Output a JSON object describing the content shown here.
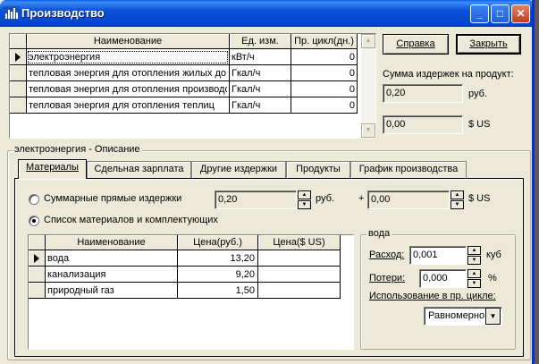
{
  "window": {
    "title": "Производство",
    "buttons": {
      "minimize": "_",
      "maximize": "□",
      "close": "✕"
    }
  },
  "products_table": {
    "columns": [
      "Наименование",
      "Ед. изм.",
      "Пр. цикл(дн.)"
    ],
    "rows": [
      {
        "name": "электроэнергия",
        "unit": "кВт/ч",
        "cycle": "0"
      },
      {
        "name": "тепловая энергия для отопления жилых до",
        "unit": "Гкал/ч",
        "cycle": "0"
      },
      {
        "name": "тепловая энергия для отопления производс",
        "unit": "Гкал/ч",
        "cycle": "0"
      },
      {
        "name": "тепловая энергия для отопления теплиц",
        "unit": "Гкал/ч",
        "cycle": "0"
      }
    ]
  },
  "right_panel": {
    "help_button": "Справка",
    "close_button": "Закрыть",
    "sum_label": "Сумма издержек на продукт:",
    "sum_rub_value": "0,20",
    "sum_rub_unit": "руб.",
    "sum_usd_value": "0,00",
    "sum_usd_unit": "$ US"
  },
  "description_group": {
    "legend": "электроэнергия - Описание",
    "tabs": [
      "Материалы",
      "Сдельная зарплата",
      "Другие издержки",
      "Продукты",
      "График производства"
    ],
    "active_tab": "Материалы"
  },
  "materials": {
    "radio_total_label": "Суммарные прямые издержки",
    "total_rub_value": "0,20",
    "total_rub_unit": "руб.",
    "plus": "+",
    "total_usd_value": "0,00",
    "total_usd_unit": "$ US",
    "radio_list_label": "Список материалов и комплектующих",
    "selected_radio": "list",
    "table": {
      "columns": [
        "Наименование",
        "Цена(руб.)",
        "Цена($ US)"
      ],
      "rows": [
        {
          "name": "вода",
          "rub": "13,20",
          "usd": ""
        },
        {
          "name": "канализация",
          "rub": "9,20",
          "usd": ""
        },
        {
          "name": "природный газ",
          "rub": "1,50",
          "usd": ""
        }
      ]
    }
  },
  "water_group": {
    "legend": "вода",
    "consumption_label": "Расход:",
    "consumption_value": "0,001",
    "consumption_unit": "куб",
    "losses_label": "Потери:",
    "losses_value": "0,000",
    "losses_unit": "%",
    "usage_label": "Использование в пр. цикле:",
    "usage_value": "Равномерно"
  }
}
